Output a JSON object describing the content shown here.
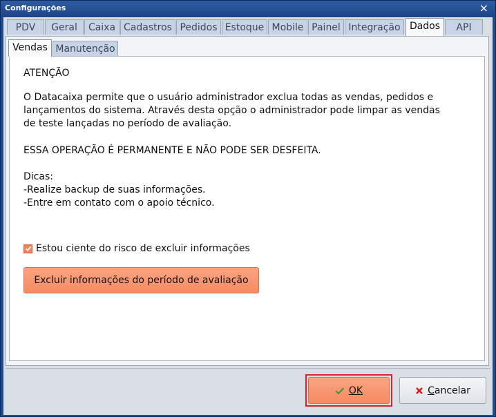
{
  "window": {
    "title": "Configurações",
    "close_glyph": "×"
  },
  "tabs": [
    {
      "label": "PDV"
    },
    {
      "label": "Geral"
    },
    {
      "label": "Caixa"
    },
    {
      "label": "Cadastros"
    },
    {
      "label": "Pedidos"
    },
    {
      "label": "Estoque"
    },
    {
      "label": "Mobile"
    },
    {
      "label": "Painel"
    },
    {
      "label": "Integração"
    },
    {
      "label": "Dados",
      "active": true
    },
    {
      "label": "API"
    }
  ],
  "subtabs": [
    {
      "label": "Vendas",
      "active": true
    },
    {
      "label": "Manutenção"
    }
  ],
  "content": {
    "heading": "ATENÇÃO",
    "para1_line1": "O Datacaixa permite que o usuário administrador exclua todas as vendas, pedidos e",
    "para1_line2": "lançamentos do sistema. Através desta opção o administrador pode limpar as vendas",
    "para1_line3": "de teste lançadas no período de avaliação.",
    "warning": "ESSA OPERAÇÃO É PERMANENTE E NÃO PODE SER DESFEITA.",
    "tips_title": "Dicas:",
    "tip1": "-Realize backup de suas informações.",
    "tip2": "-Entre em contato com o apoio técnico.",
    "checkbox_label": "Estou ciente do risco de excluir informações",
    "checkbox_checked": true,
    "delete_button": "Excluir informações do período de avaliação"
  },
  "footer": {
    "ok_label": "OK",
    "cancel_label": "Cancelar"
  },
  "colors": {
    "accent": "#f58a62",
    "titlebar": "#1f4a8f",
    "highlight": "#d8222e"
  }
}
